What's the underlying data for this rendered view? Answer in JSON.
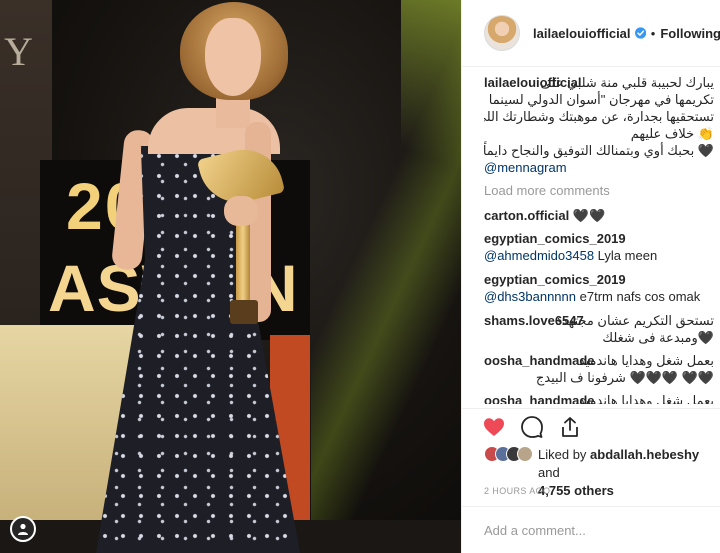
{
  "photo": {
    "backdrop_year": "2019",
    "backdrop_name": "ASWAN",
    "wall_text": "Y"
  },
  "header": {
    "username": "lailaelouiofficial",
    "separator": "•",
    "follow_label": "Following",
    "verified_icon": "verified-badge-icon"
  },
  "caption": {
    "username": "lailaelouiofficial",
    "line1": "يبارك لحبيبة قلبي منة شلبي على",
    "line2": "تكريمها في مهرجان \"أسوان الدولي لسينما المرأة\".",
    "line3": "تستحقيها بجدارة، عن موهبتك وشطارتك اللي ما بقاش في",
    "line4": "👏 خلاف عليهم",
    "line5": "🖤 بحبك أوي وبتمنالك التوفيق والنجاح دايماً في مشوارك",
    "mention": "@mennagram"
  },
  "load_more_label": "Load more comments",
  "comments": [
    {
      "user": "carton.official",
      "text": "🖤🖤",
      "mention": ""
    },
    {
      "user": "egyptian_comics_2019",
      "text": "Lyla meen",
      "mention": "@ahmedmido3458"
    },
    {
      "user": "egyptian_comics_2019",
      "text": "e7trm nafs cos omak",
      "mention": "@dhs3bannnnn"
    },
    {
      "user": "shams.love6547",
      "text": "تستحق التكريم عشان مجتهدة",
      "text2": "🖤ومبدعة فى شغلك"
    },
    {
      "user": "oosha_handmade",
      "text": "بعمل شغل وهدايا هاندميد",
      "text2": "🖤🖤 🖤🖤🖤 شرفونا ف البيدج"
    },
    {
      "user": "oosha_handmade",
      "text": "بعمل شغل وهدايا هاندميد"
    }
  ],
  "actions": {
    "like_icon": "heart-filled-icon",
    "comment_icon": "comment-icon",
    "share_icon": "share-icon",
    "like_color": "#ed4956"
  },
  "likes": {
    "prefix": "Liked by",
    "top_liker": "abdallah.hebeshy",
    "middle": "and",
    "others_count": "4,755 others"
  },
  "timestamp": "2 HOURS AGO",
  "add_comment_placeholder": "Add a comment..."
}
